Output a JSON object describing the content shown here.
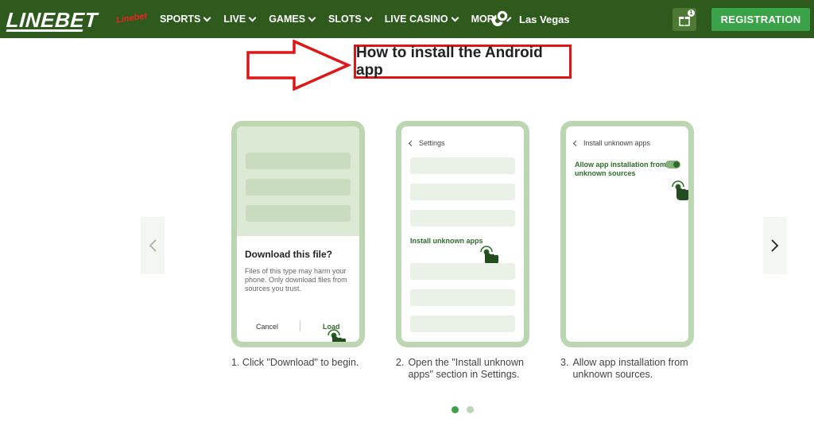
{
  "header": {
    "logo": "LINEBET",
    "promo_badge": "Linebet",
    "nav": [
      {
        "label": "SPORTS"
      },
      {
        "label": "LIVE"
      },
      {
        "label": "GAMES"
      },
      {
        "label": "SLOTS"
      },
      {
        "label": "LIVE CASINO"
      },
      {
        "label": "MORE"
      }
    ],
    "las_vegas": "Las Vegas",
    "gift_count": "1",
    "registration": "REGISTRATION"
  },
  "title": "How to install the Android app",
  "steps": [
    {
      "dialog_title": "Download this file?",
      "dialog_text": "Files of this type may harm your phone. Only download files from sources you trust.",
      "cancel": "Cancel",
      "load": "Load",
      "caption_num": "1.",
      "caption": "Click \"Download\" to begin."
    },
    {
      "header": "Settings",
      "item": "Install unknown apps",
      "caption_num": "2.",
      "caption": "Open the \"Install unknown apps\" section in Settings."
    },
    {
      "header": "Install unknown apps",
      "allow": "Allow app installation from unknown sources",
      "caption_num": "3.",
      "caption": "Allow app installation from unknown sources."
    }
  ],
  "colors": {
    "header_bg": "#2f5a1d",
    "register": "#3aa349",
    "annotation": "#e01515",
    "phone_frame": "#bcd6b1",
    "accent_text": "#2f6e2a"
  },
  "icons": [
    "chevron-down-icon",
    "poker-chips-icon",
    "gift-icon",
    "chevron-left-icon",
    "chevron-right-icon",
    "hand-tap-icon",
    "back-chevron-icon"
  ],
  "carousel": {
    "pages": 2,
    "active": 1
  }
}
